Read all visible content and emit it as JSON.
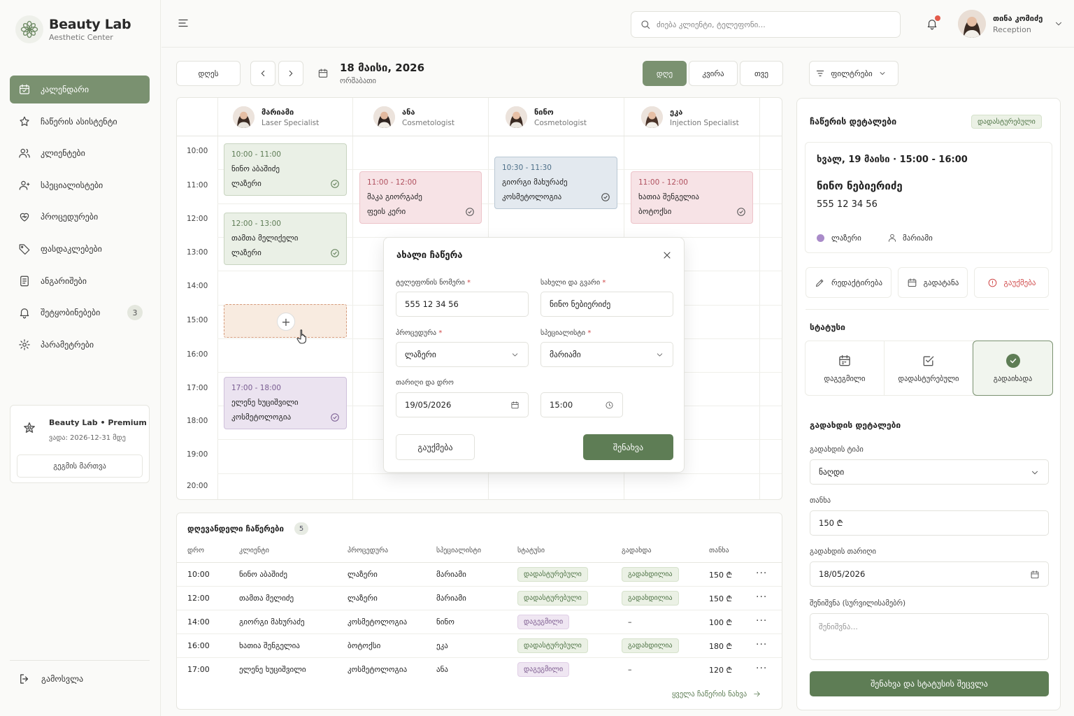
{
  "brand": {
    "name": "Beauty Lab",
    "subtitle": "Aesthetic Center"
  },
  "nav": [
    {
      "label": "კალენდარი",
      "icon": "calendar-icon",
      "active": true
    },
    {
      "label": "ჩაწერის ასისტენტი",
      "icon": "sparkle-icon"
    },
    {
      "label": "კლიენტები",
      "icon": "users-icon"
    },
    {
      "label": "სპეციალისტები",
      "icon": "specialists-icon"
    },
    {
      "label": "პროცედურები",
      "icon": "heart-icon"
    },
    {
      "label": "ფასდაკლებები",
      "icon": "tag-icon"
    },
    {
      "label": "ანგარიშები",
      "icon": "report-icon"
    },
    {
      "label": "შეტყობინებები",
      "icon": "bell-icon",
      "badge": "3"
    },
    {
      "label": "პარამეტრები",
      "icon": "gear-icon"
    }
  ],
  "plan": {
    "name": "Beauty Lab • Premium",
    "valid": "ვადა: 2026-12-31 მდე",
    "manage": "გეგმის მართვა"
  },
  "logout": "გამოსვლა",
  "search": {
    "placeholder": "ძიება კლიენტი, ტელეფონი..."
  },
  "user": {
    "name": "თინა კომიძე",
    "role": "Reception"
  },
  "toolbar": {
    "today": "დღეს",
    "date": "18 მაისი, 2026",
    "weekday": "ორშაბათი",
    "views": [
      "დღე",
      "კვირა",
      "თვე"
    ],
    "filters": "ფილტრები"
  },
  "specialists": [
    {
      "name": "მარიამი",
      "role": "Laser Specialist"
    },
    {
      "name": "ანა",
      "role": "Cosmetologist"
    },
    {
      "name": "ნინო",
      "role": "Cosmetologist"
    },
    {
      "name": "ეკა",
      "role": "Injection Specialist"
    }
  ],
  "hours": [
    "10:00",
    "11:00",
    "12:00",
    "13:00",
    "14:00",
    "15:00",
    "16:00",
    "17:00",
    "18:00",
    "19:00",
    "20:00"
  ],
  "appointments": [
    {
      "time": "10:00 - 11:00",
      "client": "ნინო აბაშიძე",
      "service": "ლაზერი"
    },
    {
      "time": "12:00 - 13:00",
      "client": "თამთა მელიქელი",
      "service": "ლაზერი"
    },
    {
      "time": "17:00 - 18:00",
      "client": "ელენე ხუციშვილი",
      "service": "კოსმეტოლოგია"
    },
    {
      "time": "11:00 - 12:00",
      "client": "მაკა გიორგაძე",
      "service": "ფეის კერი"
    },
    {
      "time": "10:30 - 11:30",
      "client": "გიორგი მახურაძე",
      "service": "კოსმეტოლოგია"
    },
    {
      "time": "11:00 - 12:00",
      "client": "ხათია შენგელია",
      "service": "ბოტოქსი"
    }
  ],
  "modal": {
    "title": "ახალი ჩაწერა",
    "phone_label": "ტელეფონის ნომერი",
    "phone": "555 12 34 56",
    "name_label": "სახელი და გვარი",
    "name": "ნინო ნებიერიძე",
    "procedure_label": "პროცედურა",
    "procedure": "ლაზერი",
    "specialist_label": "სპეციალისტი",
    "specialist": "მარიამი",
    "datetime_label": "თარიღი და დრო",
    "date": "19/05/2026",
    "time": "15:00",
    "cancel": "გაუქმება",
    "save": "შენახვა"
  },
  "today_list": {
    "title": "დღევანდელი ჩაწერები",
    "count": "5",
    "headers": [
      "დრო",
      "კლიენტი",
      "პროცედურა",
      "სპეციალისტი",
      "სტატუსი",
      "გადახდა",
      "თანხა"
    ],
    "rows": [
      {
        "time": "10:00",
        "client": "ნინო აბაშიძე",
        "procedure": "ლაზერი",
        "specialist": "მარიამი",
        "status": "დადასტურებული",
        "status_type": "conf",
        "payment": "გადახდილია",
        "amount": "150 ₾"
      },
      {
        "time": "12:00",
        "client": "თამთა მელიძე",
        "procedure": "ლაზერი",
        "specialist": "მარიამი",
        "status": "დადასტურებული",
        "status_type": "conf",
        "payment": "გადახდილია",
        "amount": "150 ₾"
      },
      {
        "time": "14:00",
        "client": "გიორგი მახურაძე",
        "procedure": "კოსმეტოლოგია",
        "specialist": "ნინო",
        "status": "დაგეგმილი",
        "status_type": "plan",
        "payment": "–",
        "amount": "100 ₾"
      },
      {
        "time": "16:00",
        "client": "ხათია შენგელია",
        "procedure": "ბოტოქსი",
        "specialist": "ეკა",
        "status": "დადასტურებული",
        "status_type": "conf",
        "payment": "გადახდილია",
        "amount": "180 ₾"
      },
      {
        "time": "17:00",
        "client": "ელენე ხუციშვილი",
        "procedure": "კოსმეტოლოგია",
        "specialist": "ანა",
        "status": "დაგეგმილი",
        "status_type": "plan",
        "payment": "–",
        "amount": "120 ₾"
      }
    ],
    "view_all": "ყველა ჩაწერის ნახვა"
  },
  "panel": {
    "title": "ჩაწერის დეტალები",
    "status_badge": "დადასტურებული",
    "date": "ხვალ, 19 მაისი",
    "time": "15:00 - 16:00",
    "client": "ნინო ნებიერიძე",
    "phone": "555 12 34 56",
    "procedure": "ლაზერი",
    "specialist": "მარიამი",
    "actions": {
      "edit": "რედაქტირება",
      "move": "გადატანა",
      "cancel": "გაუქმება"
    },
    "status_heading": "სტატუსი",
    "status_options": [
      "დაგეგმილი",
      "დადასტურებული",
      "გადაიხადა"
    ],
    "payment_heading": "გადახდის დეტალები",
    "pay_type_label": "გადახდის ტიპი",
    "pay_type": "ნაღდი",
    "amount_label": "თანხა",
    "amount": "150 ₾",
    "pay_date_label": "გადახდის თარიღი",
    "pay_date": "18/05/2026",
    "note_label": "შენიშვნა (სურვილისამებრ)",
    "note_placeholder": "შენიშვნა...",
    "save": "შენახვა და სტატუსის შეცვლა"
  },
  "colors": {
    "accent": "#7a9170",
    "accent_dark": "#5e7d55",
    "danger": "#d04a4a",
    "notify": "#e35b4b"
  }
}
